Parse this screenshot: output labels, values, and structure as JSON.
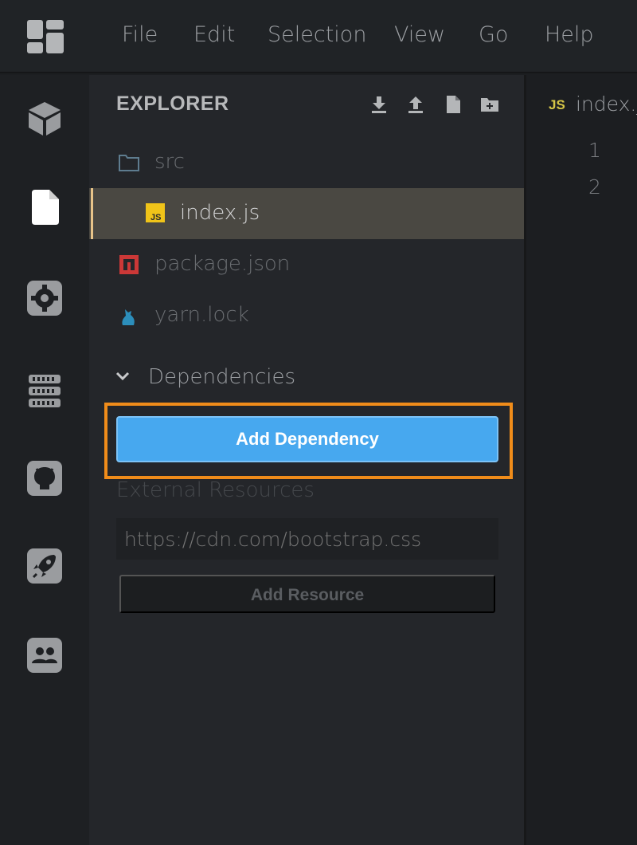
{
  "menubar": {
    "items": [
      "File",
      "Edit",
      "Selection",
      "View",
      "Go",
      "Help"
    ]
  },
  "activitybar": {
    "icons": [
      "cube-icon",
      "file-icon",
      "gear-icon",
      "server-icon",
      "github-icon",
      "rocket-icon",
      "users-icon"
    ]
  },
  "sidebar": {
    "title": "EXPLORER",
    "actions": [
      "download-icon",
      "upload-icon",
      "new-file-icon",
      "new-folder-icon"
    ],
    "tree": [
      {
        "label": "src",
        "icon": "folder-icon"
      },
      {
        "label": "index.js",
        "icon": "js-file-icon",
        "active": true
      },
      {
        "label": "package.json",
        "icon": "npm-icon"
      },
      {
        "label": "yarn.lock",
        "icon": "yarn-icon"
      }
    ],
    "dependencies": {
      "header": "Dependencies",
      "add_button": "Add Dependency"
    },
    "external": {
      "label": "External Resources",
      "placeholder": "https://cdn.com/bootstrap.css",
      "add_button": "Add Resource"
    }
  },
  "editor": {
    "tab": {
      "badge": "JS",
      "name": "index.js"
    },
    "line_numbers": [
      "1",
      "2"
    ]
  },
  "colors": {
    "accent_blue": "#47a8ef",
    "highlight_orange": "#f08c1a",
    "js_yellow": "#d6c647",
    "npm_red": "#cb3837",
    "yarn_blue": "#2c8ebb"
  }
}
